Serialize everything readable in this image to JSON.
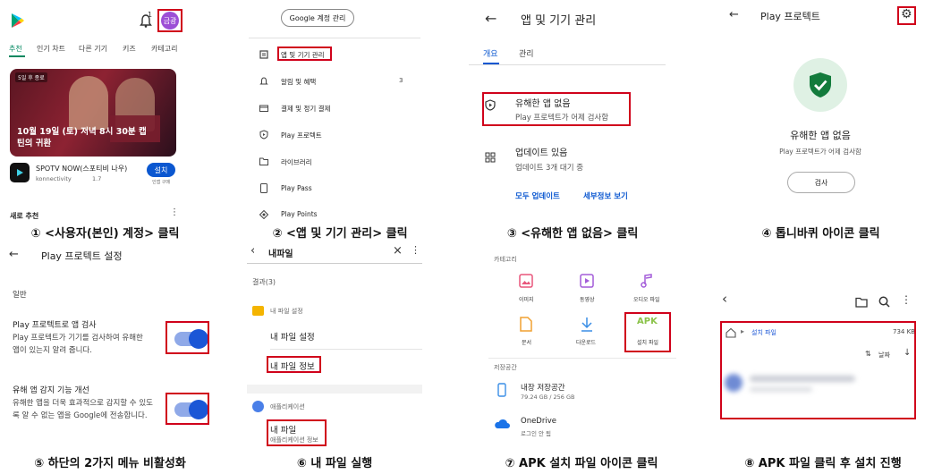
{
  "p1": {
    "tabs": [
      "추천",
      "인기 차트",
      "다른 기기",
      "키즈",
      "카테고리"
    ],
    "avatar": "금광",
    "notif_count": "1",
    "banner_badge": "5일 후 종료",
    "banner_text": "10월 19일 (토) 저녁 8시 30분 캡틴의 귀환",
    "app_name": "SPOTV NOW(스포티비 나우)",
    "app_dev": "konnectivity",
    "app_rating": "1.7",
    "install": "설치",
    "install_sub": "인앱 구매",
    "bottom": "새로 추천",
    "caption": "① <사용자(본인) 계정> 클릭"
  },
  "p2": {
    "manage_account": "Google 계정 관리",
    "menu": [
      "앱 및 기기 관리",
      "알림 및 혜택",
      "결제 및 정기 결제",
      "Play 프로텍트",
      "라이브러리",
      "Play Pass",
      "Play Points"
    ],
    "notif_count": "3",
    "caption": "② <앱 및 기기 관리> 클릭"
  },
  "p3": {
    "title": "앱 및 기기 관리",
    "tabs": [
      "개요",
      "관리"
    ],
    "item1_title": "유해한 앱 없음",
    "item1_sub": "Play 프로텍트가 어제 검사함",
    "item2_title": "업데이트 있음",
    "item2_sub": "업데이트 3개 대기 중",
    "link1": "모두 업데이트",
    "link2": "세부정보 보기",
    "caption": "③ <유해한 앱 없음> 클릭"
  },
  "p4": {
    "title": "Play 프로텍트",
    "status": "유해한 앱 없음",
    "sub": "Play 프로텍트가 어제 검사함",
    "scan": "검사",
    "caption": "④ 톱니바퀴 아이콘 클릭"
  },
  "p5": {
    "title": "Play 프로텍트 설정",
    "section": "일반",
    "item1_title": "Play 프로텍트로 앱 검사",
    "item1_desc": "Play 프로텍트가 기기를 검사하여 유해한 앱이 있는지 알려 줍니다.",
    "item2_title": "유해 앱 감지 기능 개선",
    "item2_desc": "유해한 앱을 더욱 효과적으로 감지할 수 있도록 알 수 없는 앱을 Google에 전송합니다.",
    "caption": "⑤ 하단의 2가지 메뉴 비활성화"
  },
  "p6": {
    "search": "내파일",
    "results": "결과(3)",
    "group1": "내 파일 설정",
    "item1": "내 파일 설정",
    "item2": "내 파일 정보",
    "group2": "애플리케이션",
    "app_name": "내 파일",
    "app_sub": "애플리케이션 정보",
    "caption": "⑥ 내 파일 실행"
  },
  "p7": {
    "section1": "카테고리",
    "cats": [
      "이미지",
      "동영상",
      "오디오 파일",
      "문서",
      "다운로드",
      "설치 파일"
    ],
    "apk": "APK",
    "section2": "저장공간",
    "storage1": "내장 저장공간",
    "storage1_sub": "79.24 GB / 256 GB",
    "storage2": "OneDrive",
    "storage2_sub": "로그인 안 됨",
    "caption": "⑦ APK 설치 파일 아이콘 클릭"
  },
  "p8": {
    "folder": "설치 파일",
    "size": "734 KB",
    "sort": "날짜",
    "caption": "⑧ APK 파일 클릭 후 설치 진행"
  }
}
